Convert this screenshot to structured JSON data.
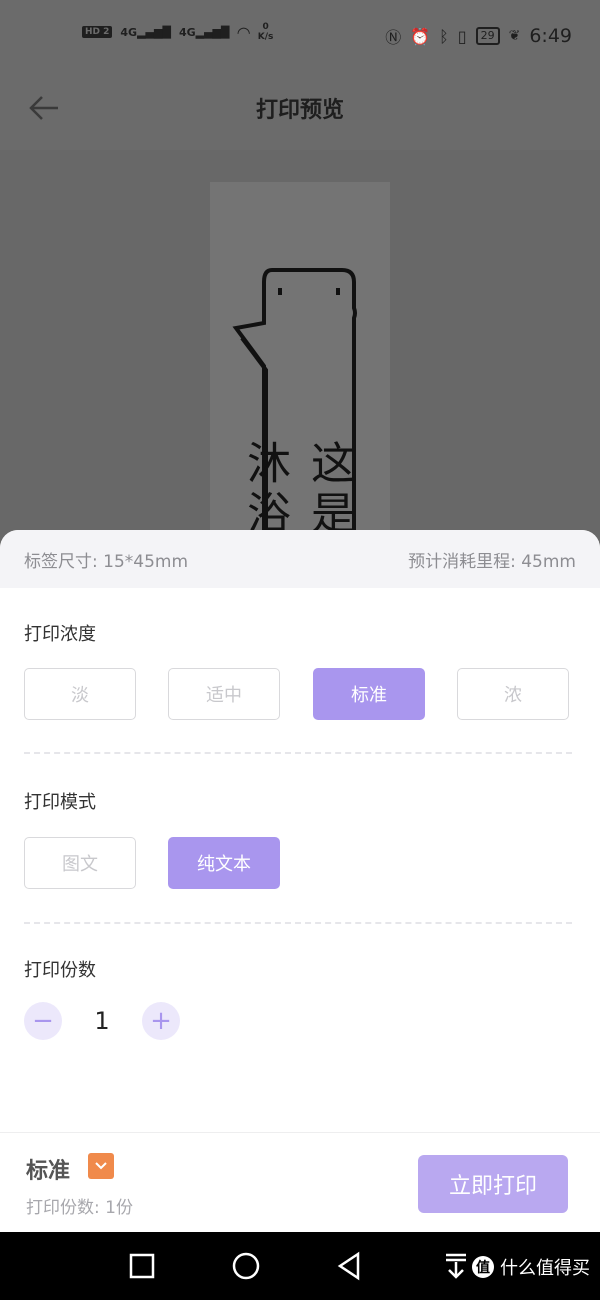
{
  "status_bar": {
    "hd_badge": "HD 2",
    "net1": "4G",
    "net2": "4G",
    "speed_value": "0",
    "speed_unit": "K/s",
    "battery": "29",
    "time": "6:49"
  },
  "header": {
    "title": "打印预览"
  },
  "preview": {
    "label_text": "这是沐浴"
  },
  "sheet": {
    "label_size": "标签尺寸: 15*45mm",
    "estimated_usage": "预计消耗里程: 45mm",
    "density": {
      "title": "打印浓度",
      "options": [
        "淡",
        "适中",
        "标准",
        "浓"
      ],
      "selected": "标准"
    },
    "mode": {
      "title": "打印模式",
      "options": [
        "图文",
        "纯文本"
      ],
      "selected": "纯文本"
    },
    "copies": {
      "title": "打印份数",
      "value": "1",
      "minus": "−",
      "plus": "+"
    }
  },
  "footer": {
    "mode_label": "标准",
    "copies_summary": "打印份数: 1份",
    "print_button": "立即打印"
  },
  "watermark": {
    "logo": "值",
    "text": "什么值得买"
  },
  "colors": {
    "accent": "#a996ee",
    "accent_light": "#ece8fb",
    "print_button": "#b9a8f0",
    "dropdown": "#f08a4b"
  }
}
